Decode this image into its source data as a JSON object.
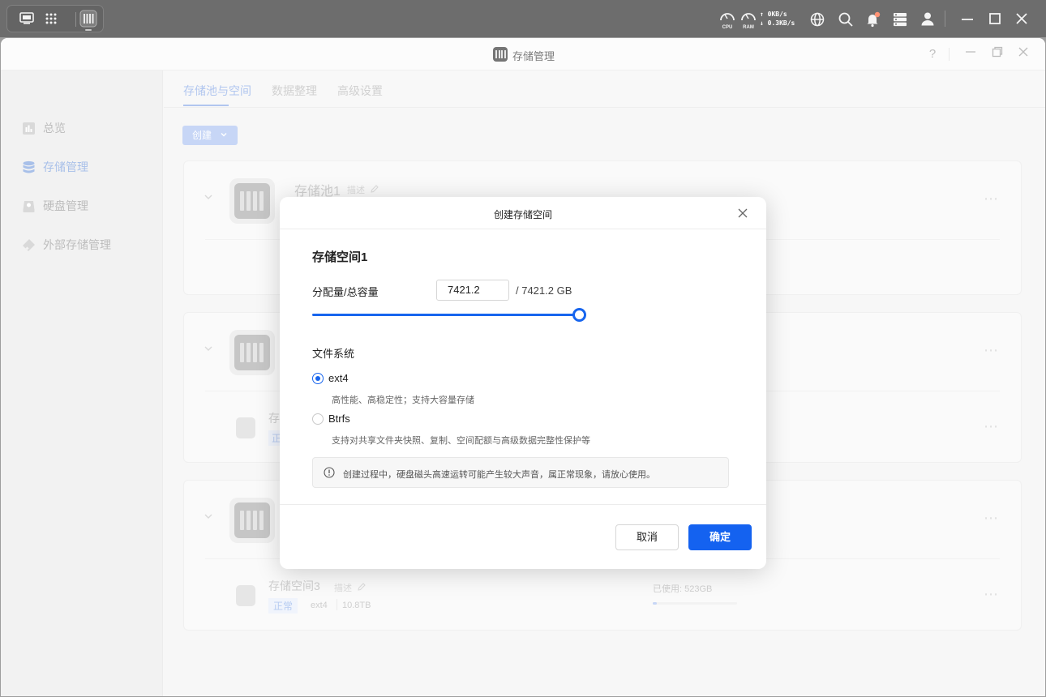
{
  "system_bar": {
    "cpu_label": "CPU",
    "ram_label": "RAM",
    "upload": "↑ 0KB/s",
    "download": "↓ 0.3KB/s"
  },
  "window": {
    "title": "存储管理"
  },
  "sidebar": {
    "items": [
      {
        "label": "总览"
      },
      {
        "label": "存储管理"
      },
      {
        "label": "硬盘管理"
      },
      {
        "label": "外部存储管理"
      }
    ]
  },
  "tabs": [
    {
      "label": "存储池与空间"
    },
    {
      "label": "数据整理"
    },
    {
      "label": "高级设置"
    }
  ],
  "create_button": "创建",
  "background": {
    "pool1_name": "存储池1",
    "pool1_desc": "描述",
    "vol2_name_partial": "存",
    "vol2_status_partial": "正",
    "vol3_name": "存储空间3",
    "vol3_desc": "描述",
    "vol3_status": "正常",
    "vol3_fs": "ext4",
    "vol3_size": "10.8TB",
    "vol3_used": "已使用: 523GB",
    "vol3_used_fraction": 0.05
  },
  "modal": {
    "title": "创建存储空间",
    "space_name": "存储空间1",
    "alloc_label": "分配量/总容量",
    "alloc_value": "7421.2",
    "total_capacity": "/  7421.2 GB",
    "allocation_fraction": 1.0,
    "fs_label": "文件系统",
    "fs_options": [
      {
        "label": "ext4",
        "desc": "高性能、高稳定性；支持大容量存储",
        "selected": true
      },
      {
        "label": "Btrfs",
        "desc": "支持对共享文件夹快照、复制、空间配额与高级数据完整性保护等",
        "selected": false
      }
    ],
    "notice": "创建过程中，硬盘磁头高速运转可能产生较大声音，属正常现象，请放心使用。",
    "cancel_label": "取消",
    "confirm_label": "确定"
  },
  "colors": {
    "accent": "#1462f0",
    "topbar": "#1f1f1f",
    "notification_badge": "#ff5a2c"
  }
}
